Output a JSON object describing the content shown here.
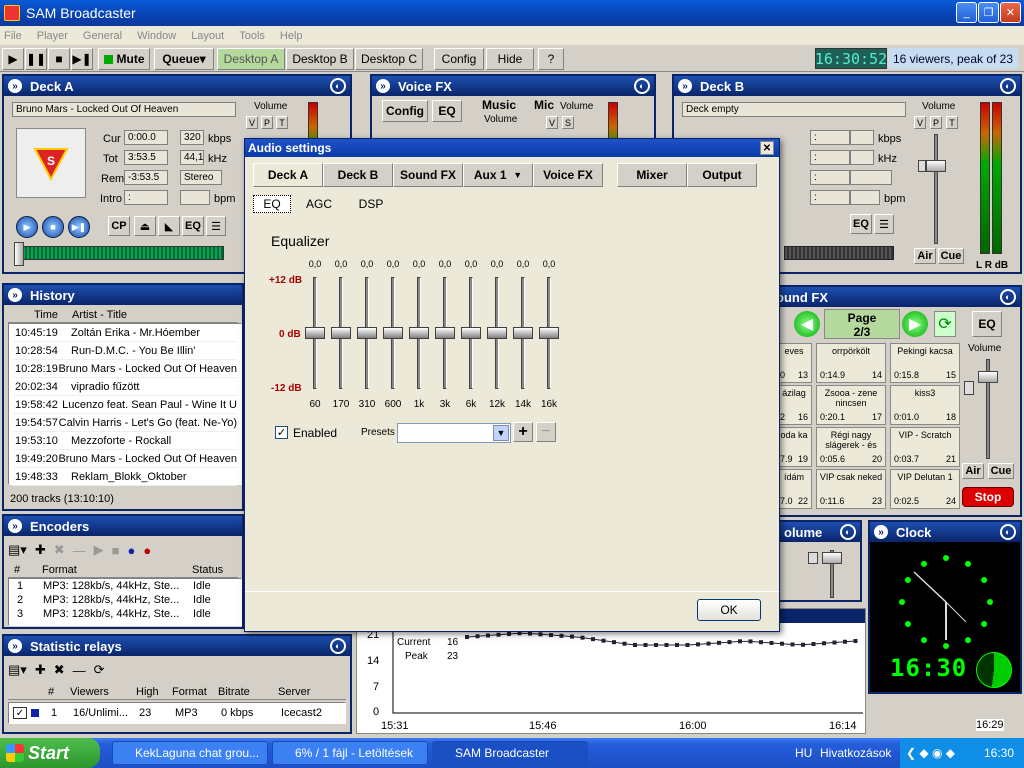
{
  "app": {
    "title": "SAM Broadcaster"
  },
  "menu": [
    "File",
    "Player",
    "General",
    "Window",
    "Layout",
    "Tools",
    "Help"
  ],
  "toolbar": {
    "mute": "Mute",
    "queue": "Queue",
    "desktops": [
      "Desktop A",
      "Desktop B",
      "Desktop C"
    ],
    "config": "Config",
    "hide": "Hide",
    "help": "?",
    "time": "16:30:52",
    "viewers": "16 viewers, peak of 23"
  },
  "deckA": {
    "title": "Deck A",
    "track": "Bruno Mars - Locked Out Of Heaven",
    "volume_label": "Volume",
    "vpt": [
      "V",
      "P",
      "T"
    ],
    "cur_label": "Cur",
    "cur": "0:00.0",
    "tot_label": "Tot",
    "tot": "3:53.5",
    "rem_label": "Rem",
    "rem": "-3:53.5",
    "intro_label": "Intro",
    "intro": ":",
    "kbps": "320",
    "kbps_unit": "kbps",
    "khz": "44,1",
    "khz_unit": "kHz",
    "mode": "Stereo",
    "bpm_unit": "bpm",
    "buttons": [
      "CP",
      "EQ"
    ]
  },
  "voiceFx": {
    "title": "Voice FX",
    "config": "Config",
    "eq": "EQ",
    "music": "Music",
    "mic": "Mic",
    "volume": "Volume",
    "vs": [
      "V",
      "S"
    ]
  },
  "deckB": {
    "title": "Deck B",
    "track": "Deck empty",
    "volume_label": "Volume",
    "vpt": [
      "V",
      "P",
      "T"
    ],
    "cur_label": "Cur",
    "tot_label": "Tot",
    "rem_label": "Rem",
    "intro_label": "Intro",
    "kbps_unit": "kbps",
    "khz_unit": "kHz",
    "bpm_unit": "bpm",
    "air": "Air",
    "cue": "Cue",
    "lr": "L R dB",
    "eq": "EQ"
  },
  "history": {
    "title": "History",
    "columns": [
      "Time",
      "Artist - Title"
    ],
    "rows": [
      [
        "10:45:19",
        "Zoltán Erika - Mr.Hóember"
      ],
      [
        "10:28:54",
        "Run-D.M.C. - You Be Illin'"
      ],
      [
        "10:28:19",
        "Bruno Mars - Locked Out Of Heaven"
      ],
      [
        "20:02:34",
        "vipradio fűzött"
      ],
      [
        "19:58:42",
        "Lucenzo feat. Sean Paul - Wine It U"
      ],
      [
        "19:54:57",
        "Calvin Harris - Let's Go (feat. Ne-Yo)"
      ],
      [
        "19:53:10",
        "Mezzoforte - Rockall"
      ],
      [
        "19:49:20",
        "Bruno Mars - Locked Out Of Heaven"
      ],
      [
        "19:48:33",
        "Reklam_Blokk_Oktober"
      ]
    ],
    "footer": "200 tracks (13:10:10)"
  },
  "encoders": {
    "title": "Encoders",
    "columns": [
      "#",
      "Format",
      "Status"
    ],
    "rows": [
      [
        "1",
        "MP3: 128kb/s, 44kHz, Ste...",
        "Idle"
      ],
      [
        "2",
        "MP3: 128kb/s, 44kHz, Ste...",
        "Idle"
      ],
      [
        "3",
        "MP3: 128kb/s, 44kHz, Ste...",
        "Idle"
      ]
    ]
  },
  "relays": {
    "title": "Statistic relays",
    "columns": [
      "#",
      "Viewers",
      "High",
      "Format",
      "Bitrate",
      "Server"
    ],
    "rows": [
      [
        "1",
        "16/Unlimi...",
        "23",
        "MP3",
        "0 kbps",
        "Icecast2"
      ]
    ]
  },
  "soundFx": {
    "title": "ound FX",
    "page_label": "Page",
    "page": "2/3",
    "eq": "EQ",
    "volume": "Volume",
    "air": "Air",
    "cue": "Cue",
    "stop": "Stop",
    "cells": [
      {
        "name": "eves",
        "time": "0",
        "num": "13"
      },
      {
        "name": "orrpörkölt",
        "time": "0:14.9",
        "num": "14"
      },
      {
        "name": "Pekingi kacsa",
        "time": "0:15.8",
        "num": "15"
      },
      {
        "name": "ázilag",
        "time": "2",
        "num": "16"
      },
      {
        "name": "Zsooa - zene nincsen",
        "time": "0:20.1",
        "num": "17"
      },
      {
        "name": "kiss3",
        "time": "0:01.0",
        "num": "18"
      },
      {
        "name": "oda ka",
        "time": "7.9",
        "num": "19"
      },
      {
        "name": "Régi nagy slágerek - és",
        "time": "0:05.6",
        "num": "20"
      },
      {
        "name": "VIP - Scratch",
        "time": "0:03.7",
        "num": "21"
      },
      {
        "name": "ídám",
        "time": "7.0",
        "num": "22"
      },
      {
        "name": "VIP csak neked",
        "time": "0:11.6",
        "num": "23"
      },
      {
        "name": "VIP Delutan 1",
        "time": "0:02.5",
        "num": "24"
      }
    ]
  },
  "volumePanel": {
    "title": "olume"
  },
  "clock": {
    "title": "Clock",
    "digital": "16:30"
  },
  "graph": {
    "current_label": "Current",
    "current": "16",
    "peak_label": "Peak",
    "peak": "23",
    "y_ticks": [
      "21",
      "14",
      "7",
      "0"
    ],
    "x_ticks": [
      "15:31",
      "15:46",
      "16:00",
      "16:14",
      "16:29"
    ]
  },
  "chart_data": {
    "type": "line",
    "title": "",
    "xlabel": "",
    "ylabel": "",
    "ylim": [
      0,
      21
    ],
    "x": [
      "15:31",
      "15:46",
      "16:00",
      "16:14",
      "16:29"
    ],
    "series": [
      {
        "name": "Current",
        "values": [
          19,
          20,
          19,
          17,
          17,
          18,
          17,
          18
        ]
      }
    ]
  },
  "dialog": {
    "title": "Audio settings",
    "tabs": [
      "Deck A",
      "Deck B",
      "Sound FX",
      "Aux 1",
      "Voice FX",
      "Mixer",
      "Output"
    ],
    "subtabs": [
      "EQ",
      "AGC",
      "DSP"
    ],
    "heading": "Equalizer",
    "db_top": "+12 dB",
    "db_mid": "0 dB",
    "db_bot": "-12 dB",
    "bands": [
      {
        "freq": "60",
        "value": "0,0"
      },
      {
        "freq": "170",
        "value": "0,0"
      },
      {
        "freq": "310",
        "value": "0,0"
      },
      {
        "freq": "600",
        "value": "0,0"
      },
      {
        "freq": "1k",
        "value": "0,0"
      },
      {
        "freq": "3k",
        "value": "0,0"
      },
      {
        "freq": "6k",
        "value": "0,0"
      },
      {
        "freq": "12k",
        "value": "0,0"
      },
      {
        "freq": "14k",
        "value": "0,0"
      },
      {
        "freq": "16k",
        "value": "0,0"
      }
    ],
    "enabled": "Enabled",
    "presets": "Presets",
    "ok": "OK"
  },
  "taskbar": {
    "start": "Start",
    "tasks": [
      "KekLaguna chat grou...",
      "6% / 1 fájl - Letöltések",
      "SAM Broadcaster"
    ],
    "lang": "HU",
    "links": "Hivatkozások",
    "time": "16:30"
  }
}
